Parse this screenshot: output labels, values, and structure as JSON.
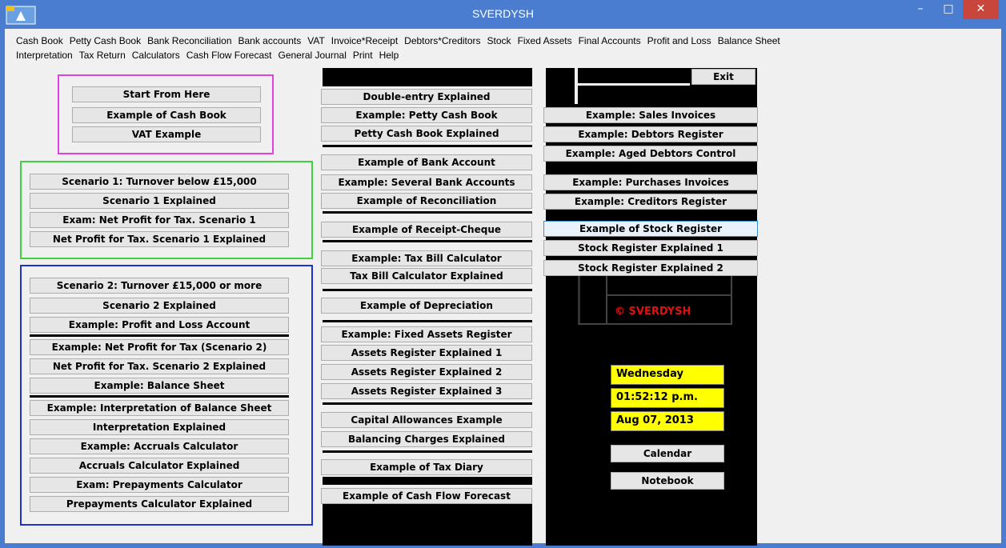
{
  "window": {
    "title": "SVERDYSH",
    "minimize": "–",
    "maximize": "□",
    "close": "✕"
  },
  "menu": {
    "row1": [
      "Cash Book",
      "Petty Cash Book",
      "Bank Reconciliation",
      "Bank accounts",
      "VAT",
      "Invoice*Receipt",
      "Debtors*Creditors",
      "Stock",
      "Fixed Assets",
      "Final Accounts",
      "Profit and Loss",
      "Balance Sheet"
    ],
    "row2": [
      "Interpretation",
      "Tax Return",
      "Calculators",
      "Cash Flow Forecast",
      "General Journal",
      "Print",
      "Help"
    ]
  },
  "col1": {
    "group1": [
      "Start From Here",
      "Example of Cash Book",
      "VAT Example"
    ],
    "group2": [
      "Scenario 1: Turnover below £15,000",
      "Scenario 1 Explained",
      "Exam: Net Profit for Tax. Scenario 1",
      "Net Profit for Tax. Scenario 1 Explained"
    ],
    "group3": [
      "Scenario 2: Turnover £15,000 or more",
      "Scenario 2 Explained",
      "Example: Profit and Loss Account",
      "Example: Net Profit for Tax (Scenario 2)",
      "Net Profit for Tax. Scenario 2 Explained",
      "Example: Balance Sheet",
      "Example: Interpretation of Balance Sheet",
      "Interpretation Explained",
      "Example: Accruals Calculator",
      "Accruals Calculator Explained",
      "Exam: Prepayments Calculator",
      "Prepayments Calculator Explained"
    ]
  },
  "col2": [
    "Double-entry Explained",
    "Example: Petty Cash Book",
    "Petty Cash Book Explained",
    "Example of Bank Account",
    "Example: Several Bank Accounts",
    "Example of Reconciliation",
    "Example of Receipt-Cheque",
    "Example: Tax Bill Calculator",
    "Tax Bill Calculator Explained",
    "Example of Depreciation",
    "Example: Fixed Assets Register",
    "Assets Register Explained 1",
    "Assets Register Explained 2",
    "Assets Register Explained 3",
    "Capital Allowances Example",
    "Balancing Charges Explained",
    "Example of Tax Diary",
    "Example of Cash Flow Forecast"
  ],
  "col3": {
    "exit": "Exit",
    "buttons": [
      "Example: Sales Invoices",
      "Example: Debtors Register",
      "Example: Aged Debtors Control",
      "Example: Purchases Invoices",
      "Example: Creditors Register",
      "Example of Stock Register",
      "Stock Register Explained 1",
      "Stock Register Explained 2"
    ],
    "copyright": "© SVERDYSH",
    "day": "Wednesday",
    "time": "01:52:12 p.m.",
    "date": "Aug 07, 2013",
    "calendar": "Calendar",
    "notebook": "Notebook"
  },
  "colors": {
    "titlebar": "#4a7cd0",
    "magenta_box": "#e040e0",
    "green_box": "#40d040",
    "blue_box": "#2030d0",
    "clock_bg": "#ffff00",
    "copyright": "#e01010"
  }
}
